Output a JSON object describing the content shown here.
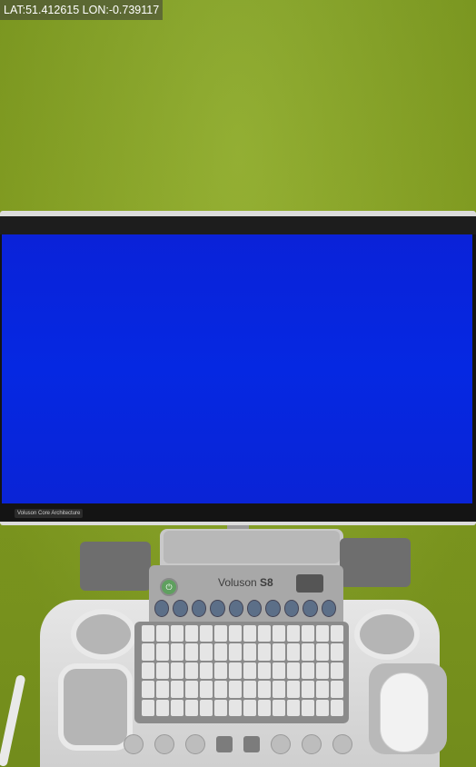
{
  "overlay": {
    "gps_text": "LAT:51.412615 LON:-0.739117"
  },
  "monitor": {
    "screen_color": "#0528e2",
    "bezel_label": "Voluson Core Architecture"
  },
  "console": {
    "brand_name": "Voluson",
    "model": "S8",
    "power_icon": "power-icon"
  },
  "colors": {
    "wall": "#8aa822",
    "screen": "#0528e2",
    "console": "#d8d8d8"
  }
}
